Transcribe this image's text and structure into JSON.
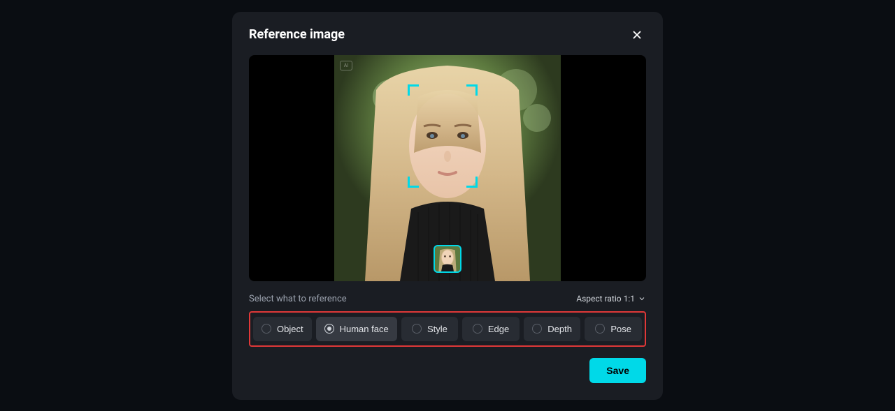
{
  "modal": {
    "title": "Reference image",
    "select_label": "Select what to reference",
    "aspect_ratio": "Aspect ratio 1:1",
    "save_label": "Save",
    "ai_badge": "AI"
  },
  "options": [
    {
      "label": "Object",
      "selected": false
    },
    {
      "label": "Human face",
      "selected": true
    },
    {
      "label": "Style",
      "selected": false
    },
    {
      "label": "Edge",
      "selected": false
    },
    {
      "label": "Depth",
      "selected": false
    },
    {
      "label": "Pose",
      "selected": false
    }
  ],
  "colors": {
    "accent": "#00d9e8",
    "highlight_border": "#e03838"
  }
}
